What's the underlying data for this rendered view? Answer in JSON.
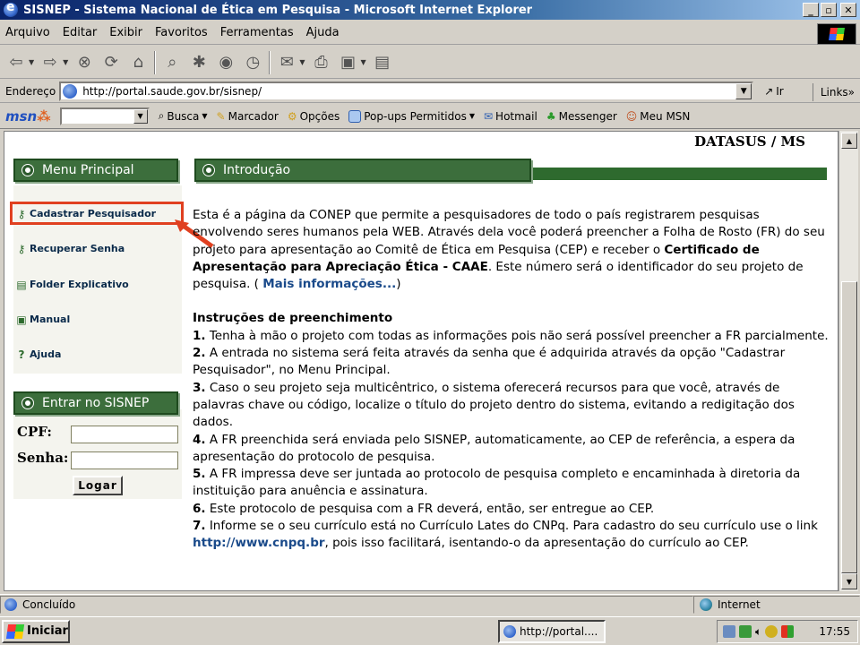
{
  "window": {
    "title": "SISNEP - Sistema Nacional de Ética em Pesquisa - Microsoft Internet Explorer",
    "minimize": "_",
    "maximize": "▫",
    "close": "✕"
  },
  "menubar": [
    "Arquivo",
    "Editar",
    "Exibir",
    "Favoritos",
    "Ferramentas",
    "Ajuda"
  ],
  "address": {
    "label": "Endereço",
    "url": "http://portal.saude.gov.br/sisnep/",
    "go_label": "Ir",
    "links_label": "Links"
  },
  "msn": {
    "logo": "msn",
    "search_value": "",
    "items": [
      "Busca",
      "Marcador",
      "Opções",
      "Pop-ups Permitidos",
      "Hotmail",
      "Messenger",
      "Meu MSN"
    ]
  },
  "page": {
    "header_right": "DATASUS / MS",
    "menu_title": "Menu Principal",
    "menu_items": [
      "Cadastrar Pesquisador",
      "Recuperar Senha",
      "Folder Explicativo",
      "Manual",
      "Ajuda"
    ],
    "login_title": "Entrar no SISNEP",
    "cpf_label": "CPF:",
    "senha_label": "Senha:",
    "cpf_value": "",
    "senha_value": "",
    "logar_label": "Logar",
    "intro_title": "Introdução",
    "intro_p1_a": "Esta é a página da CONEP que permite a pesquisadores de todo o país registrarem pesquisas envolvendo seres humanos pela WEB. Através dela você poderá preencher a Folha de Rosto (FR) do seu projeto para apresentação ao Comitê de Ética em Pesquisa (CEP) e receber o ",
    "intro_p1_b": "Certificado de Apresentação para Apreciação Ética - CAAE",
    "intro_p1_c": ". Este número será o identificador do seu projeto de pesquisa. ( ",
    "intro_p1_link": "Mais informações...",
    "intro_p1_d": ")",
    "instr_title": "Instruções de preenchimento",
    "instructions": [
      {
        "n": "1.",
        "t": " Tenha à mão o projeto com todas as informações pois não será possível preencher a FR parcialmente."
      },
      {
        "n": "2.",
        "t": " A entrada no sistema será feita através da senha que é adquirida através da opção \"Cadastrar Pesquisador\", no Menu Principal."
      },
      {
        "n": "3.",
        "t": " Caso o seu projeto seja multicêntrico, o sistema oferecerá recursos para que você, através de palavras chave ou código, localize o título do projeto dentro do sistema, evitando a redigitação dos dados."
      },
      {
        "n": "4.",
        "t": " A FR preenchida será enviada pelo SISNEP, automaticamente, ao CEP de referência, a espera da apresentação do protocolo de pesquisa."
      },
      {
        "n": "5.",
        "t": " A FR impressa deve ser juntada ao protocolo de pesquisa completo e encaminhada à diretoria da instituição para anuência e assinatura."
      },
      {
        "n": "6.",
        "t": " Este protocolo de pesquisa com a FR deverá, então, ser entregue ao CEP."
      }
    ],
    "instr7_n": "7.",
    "instr7_a": " Informe se o seu currículo está no Currículo Lates do CNPq. Para cadastro do seu currículo use o link ",
    "instr7_link": "http://www.cnpq.br",
    "instr7_b": ", pois isso facilitará, isentando-o da apresentação do currículo ao CEP."
  },
  "status": {
    "text": "Concluído",
    "zone": "Internet"
  },
  "taskbar": {
    "start": "Iniciar",
    "task": "http://portal....",
    "clock": "17:55"
  }
}
